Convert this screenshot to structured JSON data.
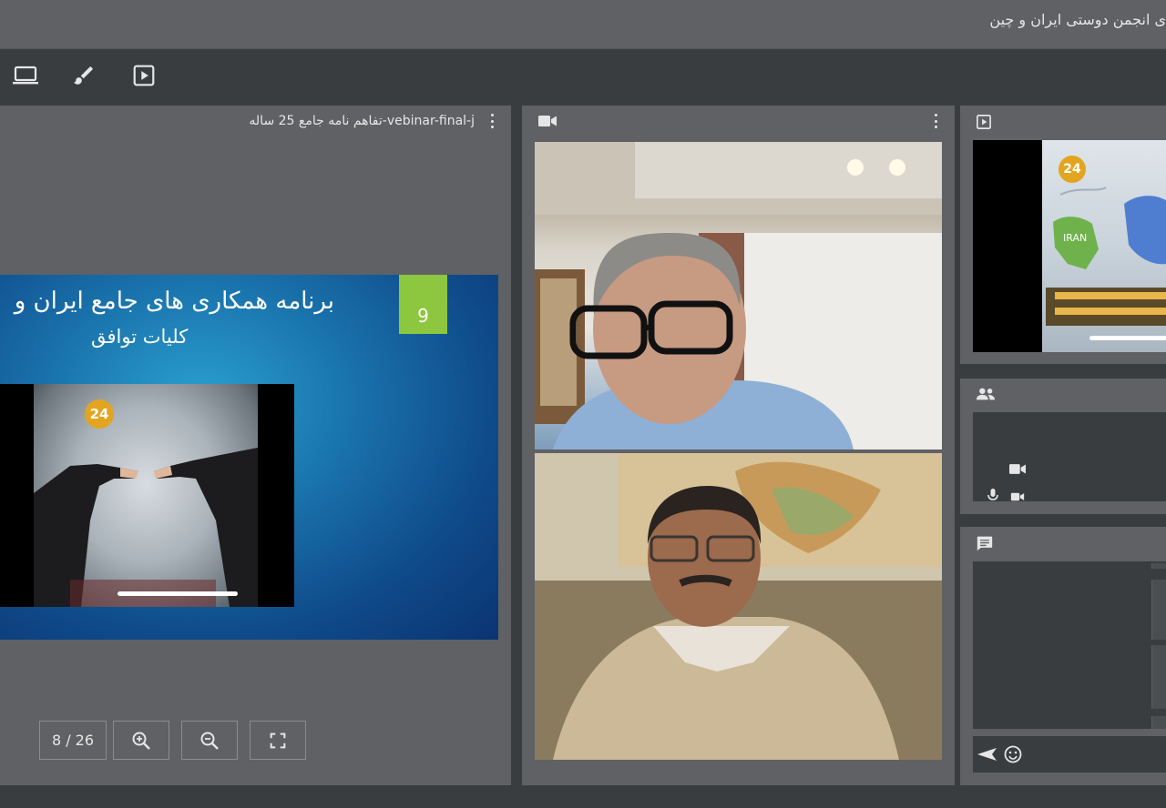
{
  "window": {
    "title": "ی انجمن دوستی ایران و چین"
  },
  "toolbar": {
    "buttons": [
      {
        "icon": "laptop-icon"
      },
      {
        "icon": "brush-icon"
      },
      {
        "icon": "play-box-icon"
      }
    ]
  },
  "presentation": {
    "file_title": "تفاهم نامه جامع 25 ساله-vebinar-final-j",
    "slide": {
      "number": "9",
      "heading": "برنامه همکاری های جامع ایران و",
      "subheading": "کلیات توافق",
      "video_logo": "24"
    },
    "page_indicator": "8 / 26"
  },
  "media_panel": {
    "thumb_logo": "24",
    "map_label": "IRAN"
  },
  "colors": {
    "panel_bg": "#5f6164",
    "app_bg": "#3a3d40",
    "slide_accent": "#8dc63f",
    "text": "#e6e6e6"
  }
}
